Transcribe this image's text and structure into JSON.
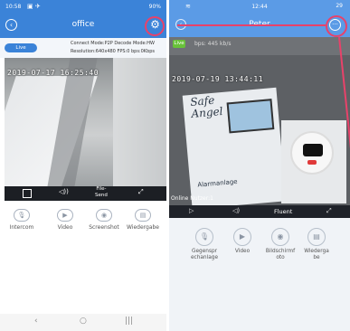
{
  "left": {
    "status": {
      "time": "10:58",
      "right": "90%"
    },
    "header": {
      "title": "office"
    },
    "info": {
      "live": "Live",
      "line1": "Connect Mode:P2P  Decode Mode:HW",
      "line2": "Resolution:640x480  FPS:0  bps:0Kbps"
    },
    "video": {
      "timestamp": "2019-07-17 16:25:40"
    },
    "controls": {
      "file_send": "File-\nSend"
    },
    "actions": [
      {
        "label": "Intercom",
        "icon": "mic-icon"
      },
      {
        "label": "Video",
        "icon": "video-icon"
      },
      {
        "label": "Screenshot",
        "icon": "camera-icon"
      },
      {
        "label": "Wiedergabe",
        "icon": "playback-icon"
      }
    ]
  },
  "right": {
    "status": {
      "time": "12:44",
      "battery": "29"
    },
    "header": {
      "title": "Peter"
    },
    "video": {
      "live": "Live",
      "bps": "bps: 445 kb/s",
      "timestamp": "2019-07-19 13:44:11",
      "online": "Online Nutzer:1",
      "brand": "Safe\nAngel",
      "device_footer": "Alarmanlage"
    },
    "controls": {
      "quality": "Fluent"
    },
    "actions": [
      {
        "label": "Gegenspr\nechanlage",
        "icon": "intercom-icon"
      },
      {
        "label": "Video",
        "icon": "video-icon"
      },
      {
        "label": "Bildschirmf\noto",
        "icon": "screenshot-icon"
      },
      {
        "label": "Wiederga\nbe",
        "icon": "playback-icon"
      }
    ]
  },
  "colors": {
    "header_blue_left": "#3b83d8",
    "header_blue_right": "#5b9be6",
    "highlight": "#e8426a",
    "live_green": "#68c23a"
  }
}
